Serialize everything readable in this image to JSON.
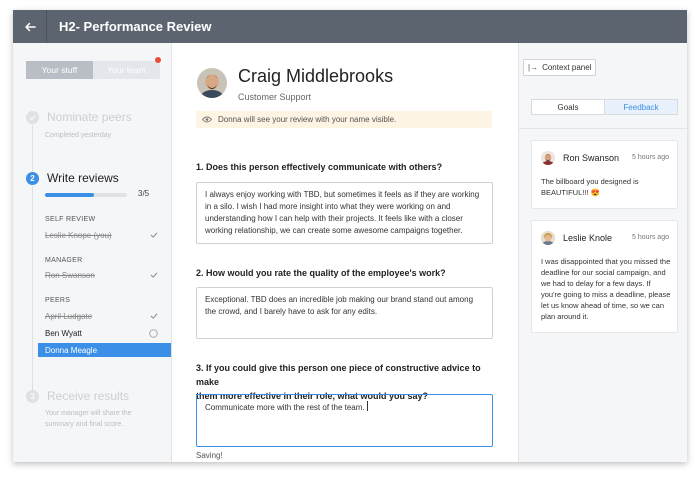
{
  "app": {
    "title": "H2- Performance Review"
  },
  "left_panel": {
    "segments": [
      {
        "label": "Your stuff"
      },
      {
        "label": "Your team"
      }
    ],
    "steps": [
      {
        "number": "",
        "title": "Nominate peers",
        "subtitle": "Completed yesterday"
      },
      {
        "number": "2",
        "title": "Write reviews",
        "progress_label": "3/5",
        "progress_fraction": 0.6
      },
      {
        "number": "3",
        "title": "Receive results",
        "subtitle_line1": "Your manager will share the",
        "subtitle_line2": "summary and final score."
      }
    ],
    "groups": {
      "self_review": {
        "label": "SELF REVIEW",
        "people": [
          {
            "name": "Leslie Knope (you)",
            "status": "done"
          }
        ]
      },
      "manager": {
        "label": "MANAGER",
        "people": [
          {
            "name": "Ron Swanson",
            "status": "done"
          }
        ]
      },
      "peers": {
        "label": "PEERS",
        "people": [
          {
            "name": "April Ludgate",
            "status": "done"
          },
          {
            "name": "Ben Wyatt",
            "status": "pending"
          },
          {
            "name": "Donna Meagle",
            "status": "selected"
          }
        ]
      }
    }
  },
  "main": {
    "employee": {
      "name": "Craig Middlebrooks",
      "role": "Customer Support"
    },
    "notice": "Donna will see your review with your name visible.",
    "questions": [
      {
        "text": "1. Does this person effectively communicate with others?",
        "answer": "I always enjoy working with TBD, but sometimes it feels as if they are working in a silo. I wish I had more insight into what they were working on and understanding how I can help with their projects. It feels like with a closer working relationship, we can create some awesome campaigns together."
      },
      {
        "text": "2. How would you rate the quality of the employee's work?",
        "answer": "Exceptional. TBD does an incredible job making our brand stand out among the crowd, and I barely have to ask for any edits."
      },
      {
        "text_line1": "3. If you could give this person one piece of constructive advice to make",
        "text_line2": "them more effective in their role, what would you say?",
        "answer": "Communicate more with the rest of the team."
      }
    ],
    "status": "Saving!"
  },
  "right_panel": {
    "context_button": "Context panel",
    "tabs": [
      {
        "label": "Goals"
      },
      {
        "label": "Feedback"
      }
    ],
    "feedback": [
      {
        "author": "Ron Swanson",
        "time": "5 hours ago",
        "message": "The billboard you designed is BEAUTIFUL!!! 😍"
      },
      {
        "author": "Leslie Knole",
        "time": "5 hours ago",
        "message": "I was  disappointed that you missed the deadline for our social campaign, and we had to delay for a few days. If you're going to miss a deadline, please let us know ahead of time, so we can plan around it."
      }
    ]
  },
  "colors": {
    "accent": "#3b8fe6",
    "topbar": "#5c6470",
    "notice_bg": "#fdf4e3"
  },
  "icons": [
    "back-arrow-icon",
    "check-icon",
    "circle-icon",
    "eye-icon",
    "panel-icon"
  ]
}
